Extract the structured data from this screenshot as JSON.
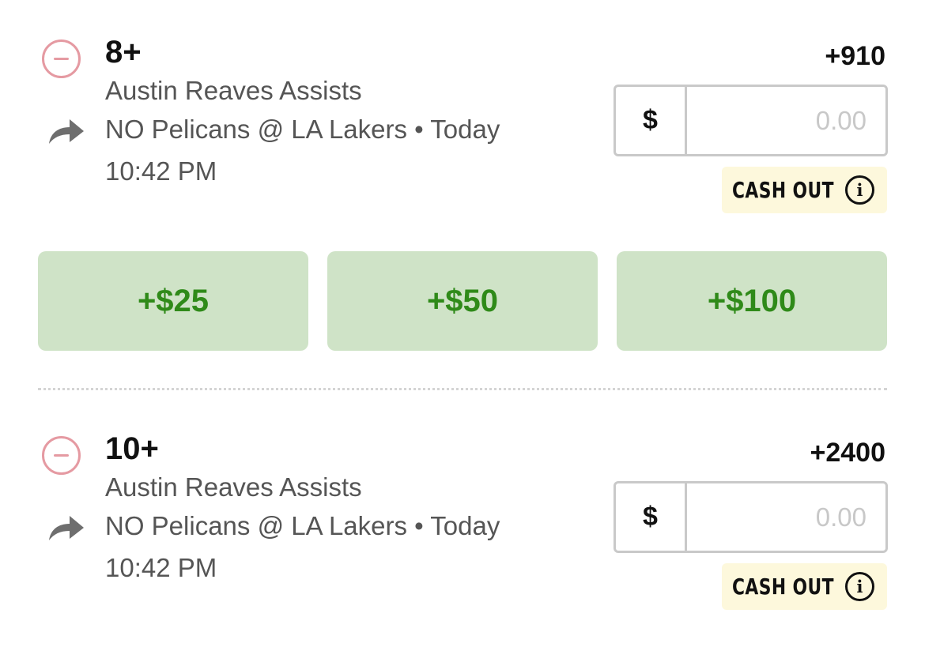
{
  "bets": [
    {
      "line": "8+",
      "market": "Austin Reaves Assists",
      "game": "NO Pelicans @ LA Lakers • Today",
      "time": "10:42 PM",
      "odds": "+910",
      "stake": {
        "currency": "$",
        "placeholder": "0.00",
        "value": ""
      },
      "cashout_label": "CASH OUT"
    },
    {
      "line": "10+",
      "market": "Austin Reaves Assists",
      "game": "NO Pelicans @ LA Lakers • Today",
      "time": "10:42 PM",
      "odds": "+2400",
      "stake": {
        "currency": "$",
        "placeholder": "0.00",
        "value": ""
      },
      "cashout_label": "CASH OUT"
    }
  ],
  "quick_stakes": [
    "+$25",
    "+$50",
    "+$100"
  ],
  "icons": {
    "remove": "minus-circle-icon",
    "share": "share-arrow-icon",
    "info": "info-icon"
  },
  "colors": {
    "remove_accent": "#e59aa2",
    "quick_bg": "#cfe3c7",
    "quick_text": "#2f8a19",
    "cashout_bg": "#fdf8dc"
  }
}
